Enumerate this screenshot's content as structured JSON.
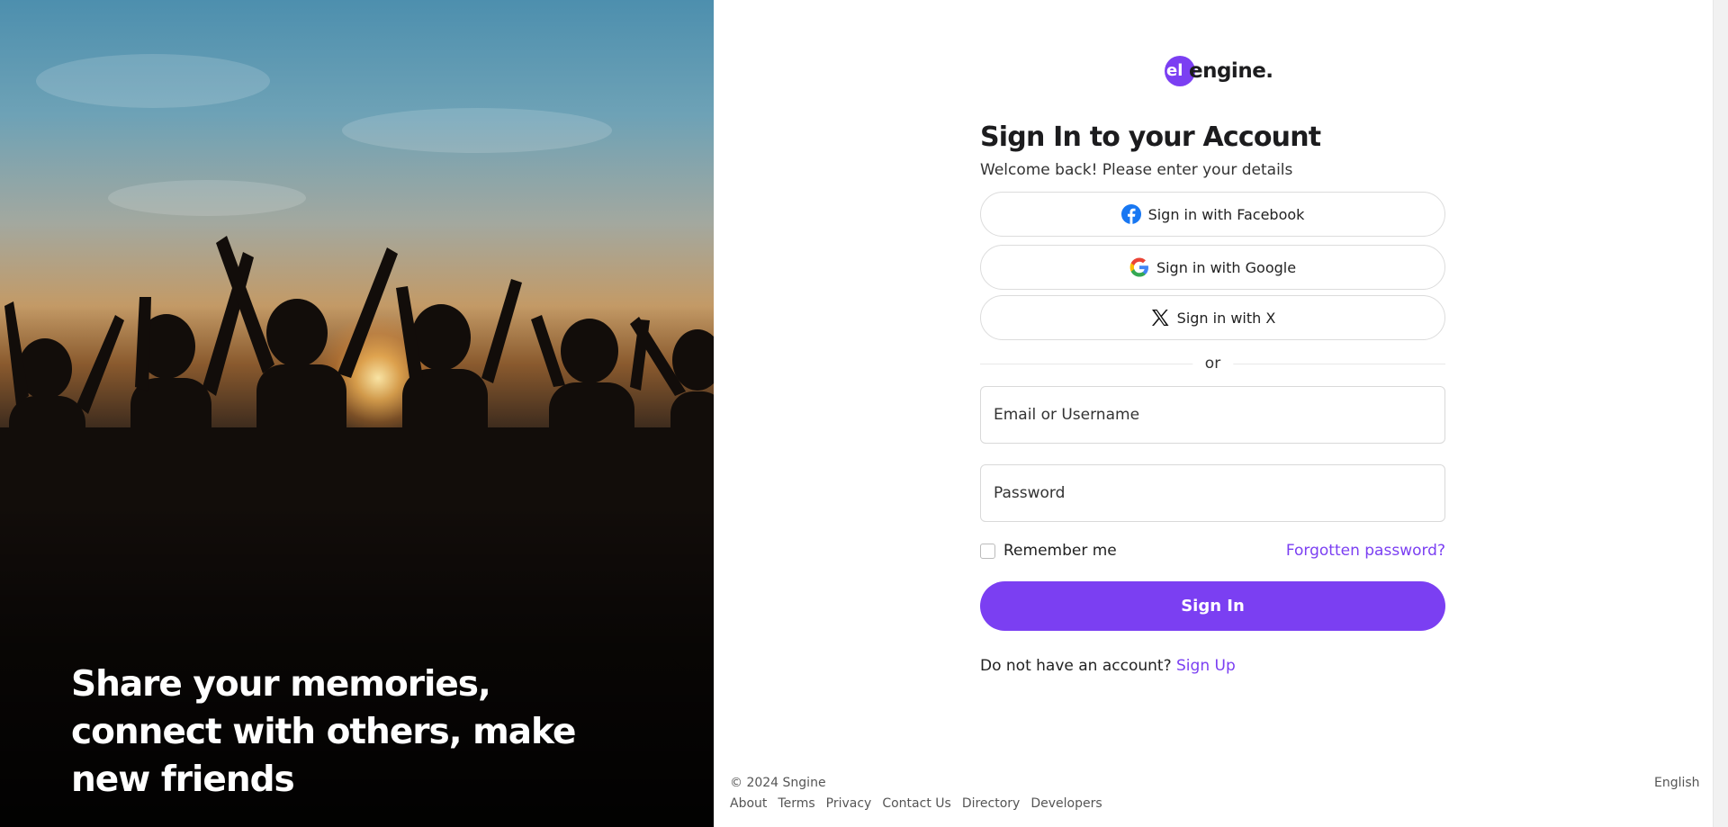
{
  "hero": {
    "headline": "Share your memories, connect with others, make new friends"
  },
  "brand": {
    "logo_mark": "el",
    "logo_text": "engine.",
    "accent_color": "#7b3ff2"
  },
  "login": {
    "title": "Sign In to your Account",
    "subtitle": "Welcome back! Please enter your details",
    "social": [
      {
        "label": "Sign in with Facebook",
        "icon": "facebook-icon"
      },
      {
        "label": "Sign in with Google",
        "icon": "google-icon"
      },
      {
        "label": "Sign in with X",
        "icon": "x-icon"
      }
    ],
    "divider_text": "or",
    "email_placeholder": "Email or Username",
    "password_placeholder": "Password",
    "remember_label": "Remember me",
    "forgot_label": "Forgotten password?",
    "submit_label": "Sign In",
    "signup_prompt": "Do not have an account?",
    "signup_link": "Sign Up"
  },
  "footer": {
    "copyright": "© 2024 Sngine",
    "links": [
      "About",
      "Terms",
      "Privacy",
      "Contact Us",
      "Directory",
      "Developers"
    ],
    "language": "English"
  }
}
